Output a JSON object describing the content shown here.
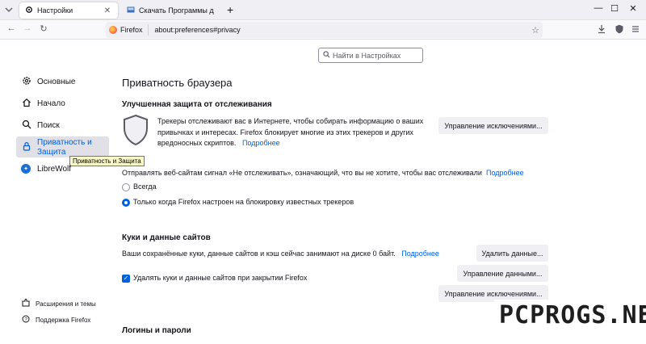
{
  "tabs": [
    {
      "label": "Настройки",
      "icon": "gear-icon",
      "active": true
    },
    {
      "label": "Скачать Программы для ком",
      "icon": "site-icon",
      "active": false
    }
  ],
  "window_controls": {
    "minimize": "—",
    "maximize": "☐",
    "close": "✕"
  },
  "urlbar": {
    "identity": "Firefox",
    "url": "about:preferences#privacy"
  },
  "search": {
    "placeholder": "Найти в Настройках"
  },
  "sidebar": {
    "items": [
      {
        "label": "Основные",
        "icon": "gear-icon"
      },
      {
        "label": "Начало",
        "icon": "home-icon"
      },
      {
        "label": "Поиск",
        "icon": "search-icon"
      },
      {
        "label": "Приватность и Защита",
        "icon": "lock-icon",
        "selected": true
      },
      {
        "label": "LibreWolf",
        "icon": "librewolf-icon"
      }
    ],
    "tooltip": "Приватность и Защита",
    "footer": [
      {
        "label": "Расширения и темы",
        "icon": "puzzle-icon"
      },
      {
        "label": "Поддержка Firefox",
        "icon": "help-icon"
      }
    ]
  },
  "main": {
    "title": "Приватность браузера",
    "tracking": {
      "heading": "Улучшенная защита от отслеживания",
      "description": "Трекеры отслеживают вас в Интернете, чтобы собирать информацию о ваших привычках и интересах. Firefox блокирует многие из этих трекеров и других вредоносных скриптов.",
      "line1": "Трекеры отслеживают вас в Интернете, чтобы собирать информацию о ваших",
      "line2": "привычках и интересах. Firefox блокирует многие из этих трекеров и других",
      "line3": "вредоносных скриптов.",
      "learn_more": "Подробнее",
      "exceptions_button": "Управление исключениями..."
    },
    "dnt": {
      "text": "Отправлять веб-сайтам сигнал «Не отслеживать», означающий, что вы не хотите, чтобы вас отслеживали",
      "learn_more": "Подробнее",
      "options": [
        {
          "label": "Всегда",
          "selected": false
        },
        {
          "label": "Только когда Firefox настроен на блокировку известных трекеров",
          "selected": true
        }
      ]
    },
    "cookies": {
      "heading": "Куки и данные сайтов",
      "description": "Ваши сохранённые куки, данные сайтов и кэш сейчас занимают на диске 0 байт.",
      "learn_more": "Подробнее",
      "clear_button": "Удалить данные...",
      "manage_button": "Управление данными...",
      "exceptions_button": "Управление исключениями...",
      "delete_on_close": {
        "label": "Удалять куки и данные сайтов при закрытии Firefox",
        "checked": true
      }
    },
    "logins": {
      "heading": "Логины и пароли"
    }
  },
  "watermark": "PCPROGS.NET",
  "colors": {
    "accent": "#0061e0",
    "tab_strip": "#f0f0f4",
    "button": "#f0f0f4"
  }
}
